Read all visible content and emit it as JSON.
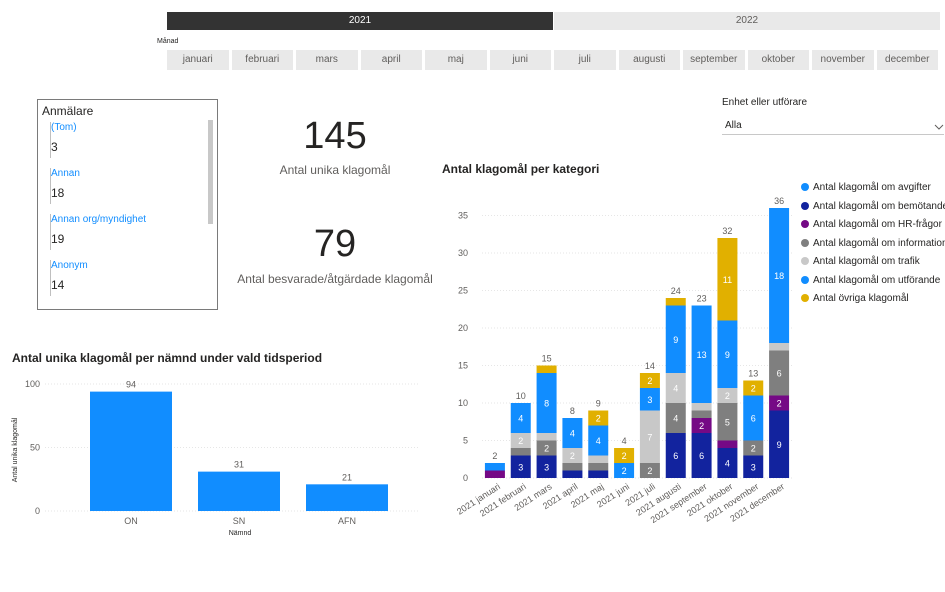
{
  "year_slicer": {
    "years": [
      "2021",
      "2022"
    ],
    "selected": "2021"
  },
  "month_slicer": {
    "label": "Månad",
    "months": [
      "januari",
      "februari",
      "mars",
      "april",
      "maj",
      "juni",
      "juli",
      "augusti",
      "september",
      "oktober",
      "november",
      "december"
    ]
  },
  "reporter_slicer": {
    "title": "Anmälare",
    "items": [
      {
        "label": "(Tom)",
        "count": "3"
      },
      {
        "label": "Annan",
        "count": "18"
      },
      {
        "label": "Annan org/myndighet",
        "count": "19"
      },
      {
        "label": "Anonym",
        "count": "14"
      }
    ]
  },
  "kpis": {
    "unique_value": "145",
    "unique_label": "Antal unika klagomål",
    "answered_value": "79",
    "answered_label": "Antal besvarade/åtgärdade klagomål"
  },
  "unit_filter": {
    "label": "Enhet eller utförare",
    "selected": "Alla"
  },
  "colors": {
    "avgifter": "#118dff",
    "bemotande": "#12239e",
    "hr": "#750985",
    "information": "#7f7f7f",
    "trafik": "#c8c8c8",
    "utforande": "#118dff",
    "ovriga": "#e1b000",
    "bar_blue": "#118dff"
  },
  "chart_data": [
    {
      "type": "bar",
      "title": "Antal unika klagomål per nämnd under vald tidsperiod",
      "xlabel": "Nämnd",
      "ylabel": "Antal unika klagomål",
      "categories": [
        "ON",
        "SN",
        "AFN"
      ],
      "values": [
        94,
        31,
        21
      ],
      "yticks": [
        0,
        50,
        100
      ],
      "ylim": [
        0,
        100
      ]
    },
    {
      "type": "bar",
      "stacked": true,
      "title": "Antal klagomål per kategori",
      "categories": [
        "2021 januari",
        "2021 februari",
        "2021 mars",
        "2021 april",
        "2021 maj",
        "2021 juni",
        "2021 juli",
        "2021 augusti",
        "2021 september",
        "2021 oktober",
        "2021 november",
        "2021 december"
      ],
      "totals": [
        2,
        10,
        15,
        8,
        9,
        4,
        14,
        24,
        23,
        32,
        13,
        36
      ],
      "ylim": [
        0,
        36
      ],
      "yticks": [
        0,
        5,
        10,
        15,
        20,
        25,
        30,
        35
      ],
      "legend_position": "right",
      "series": [
        {
          "name": "Antal klagomål om avgifter",
          "key": "avgifter",
          "values": [
            0,
            0,
            0,
            0,
            0,
            0,
            0,
            0,
            0,
            0,
            0,
            0
          ]
        },
        {
          "name": "Antal klagomål om bemötande",
          "key": "bemotande",
          "values": [
            0,
            3,
            3,
            1,
            1,
            0,
            0,
            6,
            6,
            4,
            3,
            9
          ]
        },
        {
          "name": "Antal klagomål om HR-frågor",
          "key": "hr",
          "values": [
            1,
            0,
            0,
            0,
            0,
            0,
            0,
            0,
            2,
            1,
            0,
            2
          ]
        },
        {
          "name": "Antal klagomål om information",
          "key": "information",
          "values": [
            0,
            1,
            2,
            1,
            1,
            0,
            2,
            4,
            1,
            5,
            2,
            6
          ]
        },
        {
          "name": "Antal klagomål om trafik",
          "key": "trafik",
          "values": [
            0,
            2,
            1,
            2,
            1,
            0,
            7,
            4,
            1,
            2,
            0,
            1
          ]
        },
        {
          "name": "Antal klagomål om utförande",
          "key": "utforande",
          "values": [
            1,
            4,
            8,
            4,
            4,
            2,
            3,
            9,
            13,
            9,
            6,
            18
          ]
        },
        {
          "name": "Antal övriga klagomål",
          "key": "ovriga",
          "values": [
            0,
            0,
            1,
            0,
            2,
            2,
            2,
            1,
            0,
            11,
            2,
            0
          ]
        }
      ]
    }
  ]
}
